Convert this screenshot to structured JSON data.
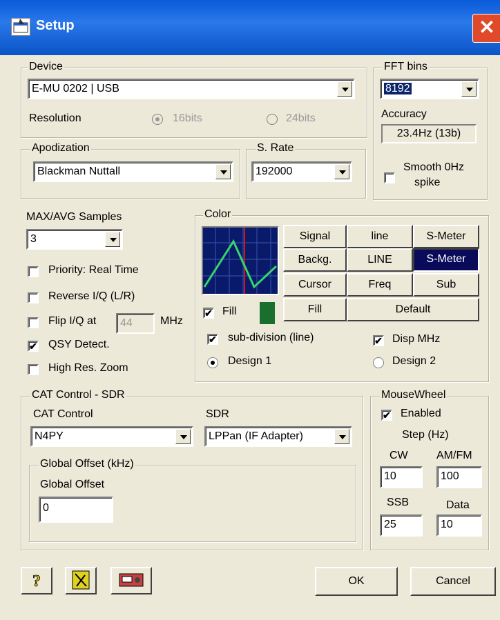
{
  "window": {
    "title": "Setup",
    "close": "✕"
  },
  "device": {
    "legend": "Device",
    "selected": "E-MU 0202 | USB",
    "resolution_label": "Resolution",
    "res_16": "16bits",
    "res_24": "24bits"
  },
  "fft": {
    "legend": "FFT bins",
    "selected": "8192",
    "accuracy_label": "Accuracy",
    "accuracy_value": "23.4Hz (13b)",
    "smooth_label_1": "Smooth 0Hz",
    "smooth_label_2": "spike"
  },
  "apodization": {
    "legend": "Apodization",
    "selected": "Blackman Nuttall"
  },
  "srate": {
    "legend": "S. Rate",
    "selected": "192000"
  },
  "samples": {
    "label": "MAX/AVG Samples",
    "selected": "3",
    "priority": "Priority: Real Time",
    "reverse": "Reverse I/Q (L/R)",
    "flip": "Flip I/Q at",
    "flip_value": "44",
    "flip_unit": "MHz",
    "qsy": "QSY Detect.",
    "highres": "High Res. Zoom"
  },
  "color": {
    "legend": "Color",
    "buttons": [
      "Signal",
      "line",
      "S-Meter",
      "Backg.",
      "LINE",
      "S-Meter",
      "Cursor",
      "Freq",
      "Sub",
      "Fill",
      "Default"
    ],
    "fill": "Fill",
    "subdiv": "sub-division (line)",
    "disp_mhz": "Disp MHz",
    "design1": "Design 1",
    "design2": "Design 2",
    "colors": {
      "preview_bg": "#0a1a6a",
      "trace": "#35d66b",
      "cursor": "#e01010",
      "fill_swatch": "#1a6e2e"
    }
  },
  "cat": {
    "legend": "CAT Control - SDR",
    "cat_label": "CAT Control",
    "cat_selected": "N4PY",
    "sdr_label": "SDR",
    "sdr_selected": "LPPan (IF Adapter)",
    "offset_legend": "Global Offset (kHz)",
    "offset_label": "Global Offset",
    "offset_value": "0"
  },
  "mouse": {
    "legend": "MouseWheel",
    "enabled": "Enabled",
    "step": "Step (Hz)",
    "cw": "CW",
    "cw_value": "10",
    "amfm": "AM/FM",
    "amfm_value": "100",
    "ssb": "SSB",
    "ssb_value": "25",
    "data": "Data",
    "data_value": "10"
  },
  "footer": {
    "ok": "OK",
    "cancel": "Cancel"
  }
}
